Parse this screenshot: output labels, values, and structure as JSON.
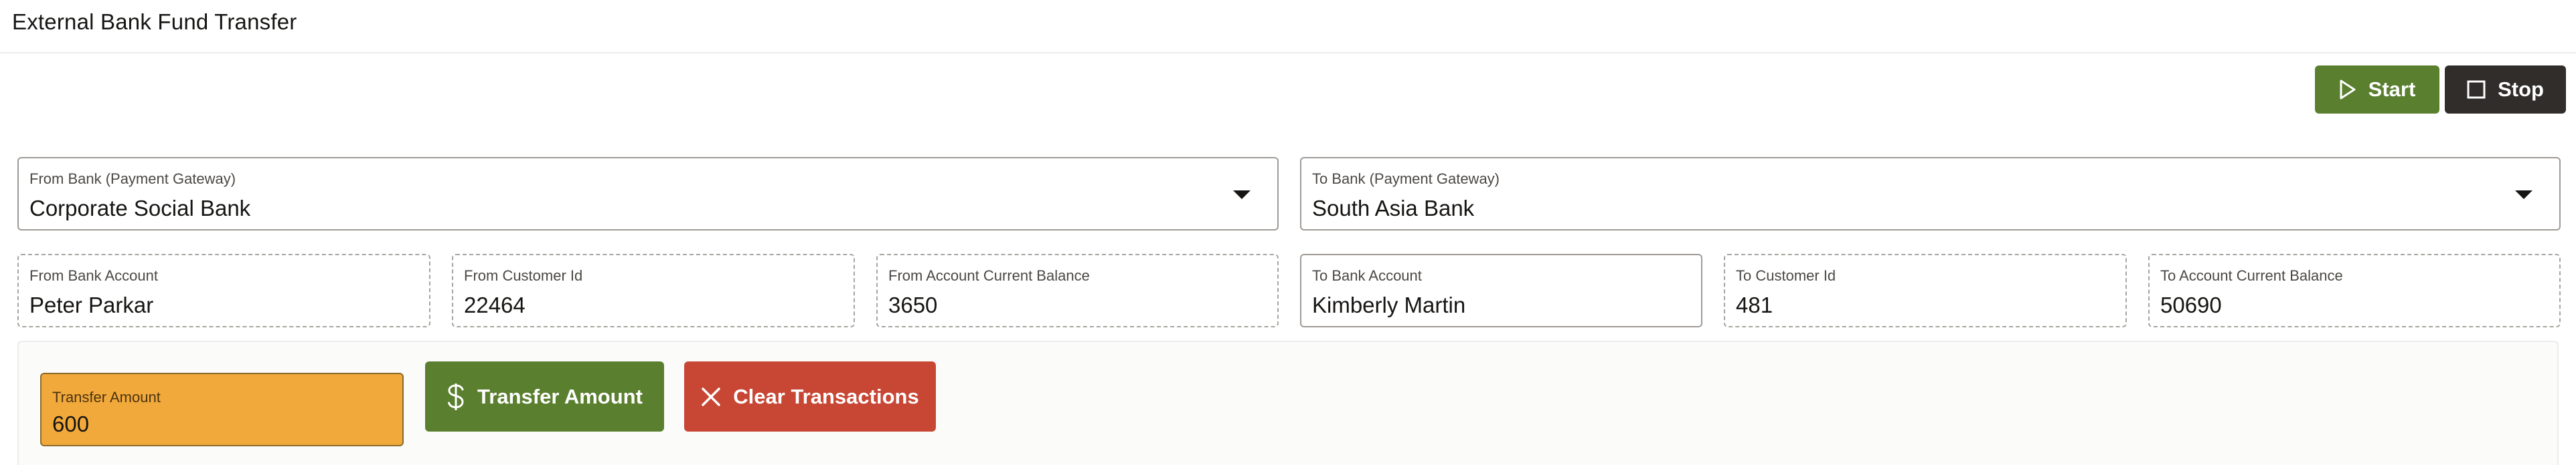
{
  "header": {
    "title": "External Bank Fund Transfer"
  },
  "toolbar": {
    "start_label": "Start",
    "stop_label": "Stop",
    "start_icon": "play-icon",
    "stop_icon": "stop-square-icon"
  },
  "from_bank": {
    "label": "From Bank (Payment Gateway)",
    "selected": "Corporate Social Bank"
  },
  "to_bank": {
    "label": "To Bank (Payment Gateway)",
    "selected": "South Asia Bank"
  },
  "from_account": {
    "bank_account_label": "From Bank Account",
    "bank_account_value": "Peter Parkar",
    "customer_id_label": "From Customer Id",
    "customer_id_value": "22464",
    "balance_label": "From Account Current Balance",
    "balance_value": "3650"
  },
  "to_account": {
    "bank_account_label": "To Bank Account",
    "bank_account_value": "Kimberly Martin",
    "customer_id_label": "To Customer Id",
    "customer_id_value": "481",
    "balance_label": "To Account Current Balance",
    "balance_value": "50690"
  },
  "transfer": {
    "amount_label": "Transfer Amount",
    "amount_value": "600",
    "transfer_button_label": "Transfer Amount",
    "clear_button_label": "Clear Transactions",
    "transfer_icon": "dollar-icon",
    "clear_icon": "close-icon"
  },
  "colors": {
    "primary_green": "#5a7f2f",
    "dark": "#312d2a",
    "danger_red": "#c74634",
    "amount_orange": "#f2a93b"
  }
}
